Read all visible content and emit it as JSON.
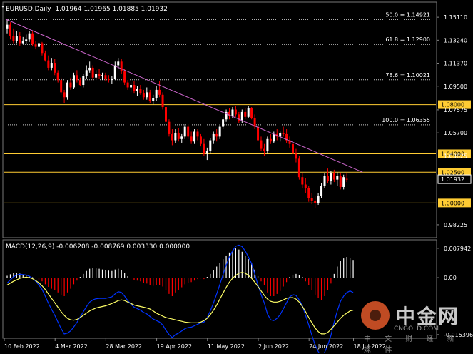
{
  "header": {
    "symbol": "EURUSD,Daily",
    "ohlc": "1.01964 1.01965 1.01885 1.01932"
  },
  "macd": {
    "label": "MACD(12,26,9) -0.006208 -0.008769 0.003330 0.000000",
    "ticks": [
      "0.007942",
      "0.00",
      "-0.015396"
    ]
  },
  "chart_data": {
    "type": "candlestick",
    "price_axis_ticks": [
      "1.15110",
      "1.13240",
      "1.11370",
      "1.09500",
      "1.07575",
      "1.05700",
      "1.03825",
      "1.01932",
      "0.98225"
    ],
    "y_range": [
      0.9735,
      1.1535
    ],
    "date_labels": [
      "10 Feb 2022",
      "4 Mar 2022",
      "28 Mar 2022",
      "19 Apr 2022",
      "11 May 2022",
      "2 Jun 2022",
      "24 Jun 2022",
      "18 Jul 2022"
    ],
    "fib_levels": [
      {
        "label": "50.0 = 1.14921",
        "value": 1.14921
      },
      {
        "label": "61.8 = 1.12900",
        "value": 1.129
      },
      {
        "label": "78.6 = 1.10021",
        "value": 1.10021
      },
      {
        "label": "100.0 = 1.06355",
        "value": 1.06355
      }
    ],
    "support_levels": [
      {
        "label": "1.08000",
        "value": 1.08
      },
      {
        "label": "1.04000",
        "value": 1.04
      },
      {
        "label": "1.02500",
        "value": 1.025
      },
      {
        "label": "1.00000",
        "value": 1.0
      }
    ],
    "current_price": {
      "label": "1.01932",
      "value": 1.01932
    },
    "candles": [
      [
        1.142,
        1.1495,
        1.138,
        1.145
      ],
      [
        1.145,
        1.147,
        1.133,
        1.136
      ],
      [
        1.136,
        1.142,
        1.13,
        1.132
      ],
      [
        1.132,
        1.14,
        1.13,
        1.136
      ],
      [
        1.136,
        1.139,
        1.128,
        1.13
      ],
      [
        1.13,
        1.135,
        1.129,
        1.132
      ],
      [
        1.132,
        1.137,
        1.129,
        1.133
      ],
      [
        1.133,
        1.14,
        1.131,
        1.138
      ],
      [
        1.138,
        1.14,
        1.128,
        1.129
      ],
      [
        1.129,
        1.132,
        1.125,
        1.127
      ],
      [
        1.127,
        1.132,
        1.123,
        1.13
      ],
      [
        1.13,
        1.131,
        1.12,
        1.122
      ],
      [
        1.122,
        1.124,
        1.115,
        1.116
      ],
      [
        1.116,
        1.12,
        1.108,
        1.11
      ],
      [
        1.11,
        1.118,
        1.108,
        1.114
      ],
      [
        1.114,
        1.117,
        1.104,
        1.106
      ],
      [
        1.106,
        1.108,
        1.098,
        1.1
      ],
      [
        1.1,
        1.102,
        1.088,
        1.09
      ],
      [
        1.09,
        1.092,
        1.081,
        1.086
      ],
      [
        1.086,
        1.1,
        1.084,
        1.098
      ],
      [
        1.098,
        1.102,
        1.092,
        1.094
      ],
      [
        1.094,
        1.106,
        1.093,
        1.104
      ],
      [
        1.104,
        1.108,
        1.098,
        1.1
      ],
      [
        1.1,
        1.102,
        1.095,
        1.096
      ],
      [
        1.096,
        1.105,
        1.094,
        1.103
      ],
      [
        1.103,
        1.112,
        1.101,
        1.108
      ],
      [
        1.108,
        1.115,
        1.106,
        1.11
      ],
      [
        1.11,
        1.112,
        1.1,
        1.102
      ],
      [
        1.102,
        1.108,
        1.1,
        1.105
      ],
      [
        1.105,
        1.109,
        1.101,
        1.103
      ],
      [
        1.103,
        1.106,
        1.1,
        1.104
      ],
      [
        1.104,
        1.106,
        1.099,
        1.101
      ],
      [
        1.101,
        1.104,
        1.098,
        1.1
      ],
      [
        1.1,
        1.103,
        1.097,
        1.101
      ],
      [
        1.101,
        1.115,
        1.1,
        1.112
      ],
      [
        1.112,
        1.118,
        1.109,
        1.115
      ],
      [
        1.115,
        1.117,
        1.105,
        1.107
      ],
      [
        1.107,
        1.109,
        1.096,
        1.098
      ],
      [
        1.098,
        1.1,
        1.092,
        1.094
      ],
      [
        1.094,
        1.098,
        1.09,
        1.096
      ],
      [
        1.096,
        1.099,
        1.089,
        1.091
      ],
      [
        1.091,
        1.095,
        1.087,
        1.093
      ],
      [
        1.093,
        1.096,
        1.088,
        1.089
      ],
      [
        1.089,
        1.092,
        1.084,
        1.086
      ],
      [
        1.086,
        1.094,
        1.084,
        1.09
      ],
      [
        1.09,
        1.092,
        1.081,
        1.083
      ],
      [
        1.083,
        1.088,
        1.08,
        1.085
      ],
      [
        1.085,
        1.095,
        1.083,
        1.092
      ],
      [
        1.092,
        1.099,
        1.086,
        1.088
      ],
      [
        1.088,
        1.09,
        1.076,
        1.078
      ],
      [
        1.078,
        1.08,
        1.065,
        1.066
      ],
      [
        1.066,
        1.068,
        1.054,
        1.056
      ],
      [
        1.056,
        1.06,
        1.047,
        1.051
      ],
      [
        1.051,
        1.06,
        1.049,
        1.057
      ],
      [
        1.057,
        1.061,
        1.05,
        1.052
      ],
      [
        1.052,
        1.056,
        1.049,
        1.054
      ],
      [
        1.054,
        1.064,
        1.052,
        1.062
      ],
      [
        1.062,
        1.064,
        1.052,
        1.054
      ],
      [
        1.054,
        1.058,
        1.048,
        1.05
      ],
      [
        1.05,
        1.06,
        1.048,
        1.058
      ],
      [
        1.058,
        1.06,
        1.051,
        1.054
      ],
      [
        1.054,
        1.056,
        1.046,
        1.048
      ],
      [
        1.048,
        1.052,
        1.038,
        1.04
      ],
      [
        1.04,
        1.045,
        1.035,
        1.042
      ],
      [
        1.042,
        1.053,
        1.04,
        1.051
      ],
      [
        1.051,
        1.058,
        1.048,
        1.056
      ],
      [
        1.056,
        1.06,
        1.05,
        1.054
      ],
      [
        1.054,
        1.064,
        1.052,
        1.062
      ],
      [
        1.062,
        1.07,
        1.06,
        1.068
      ],
      [
        1.068,
        1.076,
        1.066,
        1.074
      ],
      [
        1.074,
        1.077,
        1.068,
        1.071
      ],
      [
        1.071,
        1.078,
        1.069,
        1.076
      ],
      [
        1.076,
        1.079,
        1.07,
        1.072
      ],
      [
        1.072,
        1.074,
        1.065,
        1.067
      ],
      [
        1.067,
        1.076,
        1.065,
        1.074
      ],
      [
        1.074,
        1.077,
        1.068,
        1.07
      ],
      [
        1.07,
        1.079,
        1.069,
        1.077
      ],
      [
        1.077,
        1.078,
        1.068,
        1.069
      ],
      [
        1.069,
        1.072,
        1.06,
        1.062
      ],
      [
        1.062,
        1.064,
        1.05,
        1.051
      ],
      [
        1.051,
        1.054,
        1.042,
        1.044
      ],
      [
        1.044,
        1.048,
        1.038,
        1.042
      ],
      [
        1.042,
        1.054,
        1.04,
        1.052
      ],
      [
        1.052,
        1.056,
        1.048,
        1.05
      ],
      [
        1.05,
        1.058,
        1.049,
        1.056
      ],
      [
        1.056,
        1.06,
        1.051,
        1.054
      ],
      [
        1.054,
        1.058,
        1.05,
        1.057
      ],
      [
        1.057,
        1.062,
        1.054,
        1.056
      ],
      [
        1.056,
        1.06,
        1.049,
        1.051
      ],
      [
        1.051,
        1.054,
        1.045,
        1.048
      ],
      [
        1.048,
        1.05,
        1.038,
        1.04
      ],
      [
        1.04,
        1.044,
        1.033,
        1.036
      ],
      [
        1.036,
        1.038,
        1.019,
        1.021
      ],
      [
        1.021,
        1.024,
        1.012,
        1.015
      ],
      [
        1.015,
        1.02,
        1.008,
        1.012
      ],
      [
        1.012,
        1.014,
        1.001,
        1.004
      ],
      [
        1.004,
        1.008,
        0.999,
        1.002
      ],
      [
        1.002,
        1.006,
        0.996,
        1.0
      ],
      [
        1.0,
        1.008,
        0.9985,
        1.006
      ],
      [
        1.006,
        1.016,
        1.004,
        1.014
      ],
      [
        1.014,
        1.024,
        1.012,
        1.022
      ],
      [
        1.022,
        1.028,
        1.016,
        1.018
      ],
      [
        1.018,
        1.026,
        1.015,
        1.024
      ],
      [
        1.024,
        1.027,
        1.017,
        1.019
      ],
      [
        1.019,
        1.025,
        1.014,
        1.022
      ],
      [
        1.022,
        1.024,
        1.011,
        1.013
      ],
      [
        1.013,
        1.023,
        1.011,
        1.021
      ],
      [
        1.0196,
        1.024,
        1.017,
        1.01932
      ]
    ],
    "macd_hist": [
      0.0005,
      0.0009,
      0.0012,
      0.0013,
      0.0011,
      0.0008,
      0.0006,
      0.0004,
      0.0001,
      -0.0002,
      -0.0006,
      -0.001,
      -0.0018,
      -0.0025,
      -0.003,
      -0.0034,
      -0.004,
      -0.0046,
      -0.005,
      -0.004,
      -0.003,
      -0.0018,
      -0.0008,
      0.0002,
      0.001,
      0.0018,
      0.0024,
      0.0026,
      0.0025,
      0.0024,
      0.0022,
      0.002,
      0.0019,
      0.0018,
      0.0022,
      0.0024,
      0.002,
      0.0012,
      0.0004,
      -0.0002,
      -0.0006,
      -0.0008,
      -0.001,
      -0.0014,
      -0.0016,
      -0.002,
      -0.0022,
      -0.002,
      -0.002,
      -0.0024,
      -0.0034,
      -0.0044,
      -0.005,
      -0.004,
      -0.0034,
      -0.0026,
      -0.0018,
      -0.0014,
      -0.0012,
      -0.0008,
      -0.0004,
      -0.0002,
      -0.0004,
      0.0002,
      0.001,
      0.002,
      0.003,
      0.004,
      0.005,
      0.006,
      0.0068,
      0.0074,
      0.0079,
      0.0076,
      0.007,
      0.006,
      0.005,
      0.004,
      0.0022,
      0.0004,
      -0.001,
      -0.002,
      -0.004,
      -0.005,
      -0.005,
      -0.0044,
      -0.0036,
      -0.0024,
      -0.0012,
      0.0002,
      0.0008,
      0.001,
      0.0006,
      0.0002,
      -0.001,
      -0.002,
      -0.0034,
      -0.0046,
      -0.0054,
      -0.006,
      -0.005,
      -0.0034,
      -0.0016,
      0.001,
      0.003,
      0.0046,
      0.0052,
      0.0056,
      0.0054,
      0.0048
    ],
    "macd_signal": [
      -0.002,
      -0.0015,
      -0.001,
      -0.0006,
      -0.0002,
      0.0,
      0.0001,
      0.0,
      -0.0003,
      -0.0008,
      -0.0014,
      -0.0022,
      -0.0032,
      -0.0044,
      -0.0056,
      -0.0068,
      -0.008,
      -0.0092,
      -0.0102,
      -0.011,
      -0.0114,
      -0.0115,
      -0.0113,
      -0.0108,
      -0.0102,
      -0.0096,
      -0.009,
      -0.0086,
      -0.0082,
      -0.008,
      -0.0078,
      -0.0076,
      -0.0073,
      -0.007,
      -0.0066,
      -0.0062,
      -0.006,
      -0.0062,
      -0.0066,
      -0.007,
      -0.0074,
      -0.0076,
      -0.0078,
      -0.008,
      -0.0082,
      -0.0085,
      -0.009,
      -0.0096,
      -0.01,
      -0.0104,
      -0.0108,
      -0.011,
      -0.0112,
      -0.0114,
      -0.0116,
      -0.0118,
      -0.012,
      -0.0121,
      -0.0122,
      -0.0122,
      -0.0122,
      -0.012,
      -0.0116,
      -0.011,
      -0.01,
      -0.0088,
      -0.0074,
      -0.0058,
      -0.0042,
      -0.0026,
      -0.0012,
      -0.0002,
      0.0006,
      0.0012,
      0.0014,
      0.0012,
      0.0006,
      -0.0002,
      -0.0012,
      -0.0024,
      -0.0036,
      -0.0048,
      -0.0058,
      -0.0064,
      -0.0066,
      -0.0066,
      -0.0064,
      -0.006,
      -0.0056,
      -0.0054,
      -0.0054,
      -0.0058,
      -0.0066,
      -0.0078,
      -0.0092,
      -0.0108,
      -0.0122,
      -0.0136,
      -0.0146,
      -0.0152,
      -0.0152,
      -0.0148,
      -0.014,
      -0.013,
      -0.012,
      -0.011,
      -0.0102,
      -0.0096,
      -0.009,
      -0.0088
    ],
    "macd_line": [
      -0.0015,
      -0.0006,
      0.0002,
      0.0007,
      0.0009,
      0.0008,
      0.0007,
      0.0004,
      -0.0002,
      -0.001,
      -0.002,
      -0.0032,
      -0.005,
      -0.0069,
      -0.0086,
      -0.0102,
      -0.012,
      -0.0138,
      -0.0152,
      -0.015,
      -0.0144,
      -0.0133,
      -0.0121,
      -0.0106,
      -0.0092,
      -0.0078,
      -0.0066,
      -0.006,
      -0.0057,
      -0.0056,
      -0.0056,
      -0.0056,
      -0.0054,
      -0.0052,
      -0.0044,
      -0.0038,
      -0.004,
      -0.005,
      -0.0062,
      -0.0072,
      -0.008,
      -0.0084,
      -0.0088,
      -0.0094,
      -0.0098,
      -0.0105,
      -0.0112,
      -0.0116,
      -0.012,
      -0.0128,
      -0.0142,
      -0.0154,
      -0.0162,
      -0.0154,
      -0.015,
      -0.0144,
      -0.0138,
      -0.0135,
      -0.0134,
      -0.013,
      -0.0126,
      -0.0122,
      -0.012,
      -0.0108,
      -0.009,
      -0.0068,
      -0.0044,
      -0.0018,
      0.0008,
      0.0034,
      0.0056,
      0.0072,
      0.0085,
      0.0088,
      0.0084,
      0.0072,
      0.0056,
      0.0038,
      0.001,
      -0.002,
      -0.0046,
      -0.0068,
      -0.0098,
      -0.0114,
      -0.0116,
      -0.011,
      -0.01,
      -0.0084,
      -0.0068,
      -0.0052,
      -0.0046,
      -0.0048,
      -0.006,
      -0.0076,
      -0.0102,
      -0.0128,
      -0.0156,
      -0.0182,
      -0.02,
      -0.0212,
      -0.0202,
      -0.0182,
      -0.0156,
      -0.012,
      -0.009,
      -0.0064,
      -0.005,
      -0.004,
      -0.0036,
      -0.004
    ],
    "macd_range": [
      -0.016,
      0.0085
    ],
    "trendline": {
      "from": [
        0,
        1.1495
      ],
      "to": [
        112,
        1.025
      ]
    },
    "colors": {
      "bull": "#ffffff",
      "bear": "#ff0000",
      "fib": "#ffffff",
      "support": "#ffcc33",
      "trend": "#cc66cc",
      "signal": "#ffff66",
      "macd": "#0033ff",
      "hist_pos": "#ffffff",
      "hist_neg": "#ff0000"
    }
  },
  "watermark": {
    "title": "中金网",
    "url": "CNGOLD.COM",
    "tagline": "中 文 财 经 新 媒 体"
  }
}
